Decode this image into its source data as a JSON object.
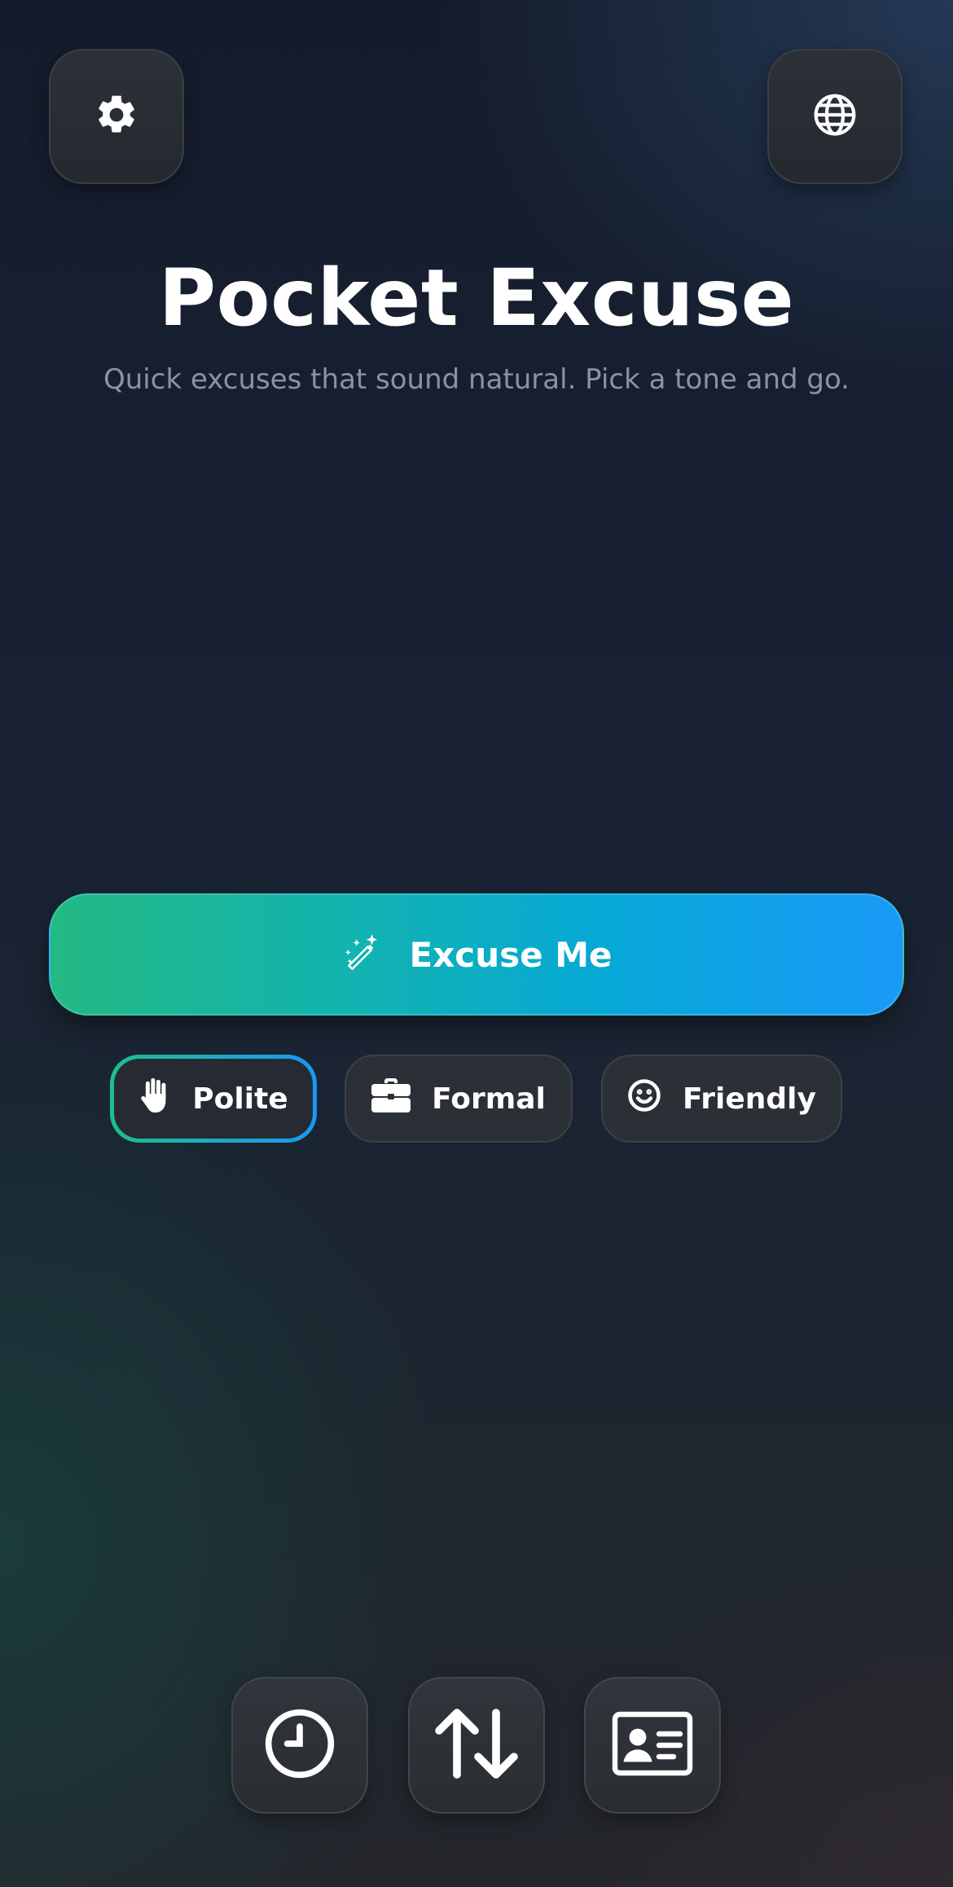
{
  "header": {
    "settings_icon": "gear-icon",
    "language_icon": "globe-icon"
  },
  "app": {
    "title": "Pocket Excuse",
    "subtitle": "Quick excuses that sound natural. Pick a tone and go."
  },
  "primary_action": {
    "label": "Excuse Me",
    "icon": "magic-wand-icon",
    "gradient": [
      "#23b983",
      "#199af8"
    ]
  },
  "tones": [
    {
      "label": "Polite",
      "icon": "hand-icon",
      "selected": true
    },
    {
      "label": "Formal",
      "icon": "briefcase-icon",
      "selected": false
    },
    {
      "label": "Friendly",
      "icon": "smile-icon",
      "selected": false
    }
  ],
  "dock": [
    {
      "icon": "clock-icon"
    },
    {
      "icon": "up-down-arrows-icon"
    },
    {
      "icon": "id-card-icon"
    }
  ]
}
